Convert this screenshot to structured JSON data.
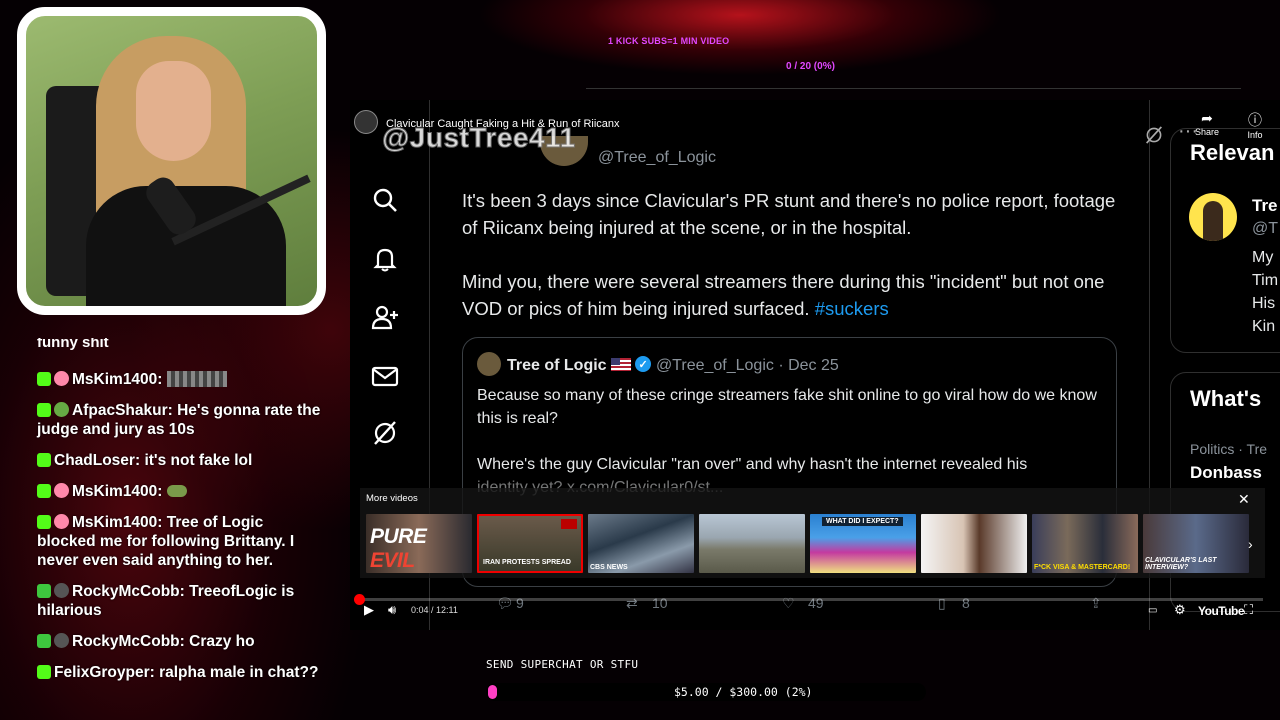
{
  "overlay": {
    "kick_subs": "1 KICK SUBS=1 MIN VIDEO",
    "goal_count": "0 / 20 (0%)"
  },
  "chat": {
    "clipped_top": "funny shit",
    "messages": [
      {
        "platform": "kick",
        "user": "MsKim1400",
        "text": "",
        "emote": "blurred-emote"
      },
      {
        "platform": "kick",
        "user": "AfpacShakur",
        "text": "He's gonna rate the judge and jury as 10s"
      },
      {
        "platform": "kick",
        "user": "ChadLoser",
        "text": "it's not fake lol"
      },
      {
        "platform": "kick",
        "user": "MsKim1400",
        "text": "",
        "emote": "frog-emote"
      },
      {
        "platform": "kick",
        "user": "MsKim1400",
        "text": "Tree of Logic blocked me for following Brittany. I never even said anything to her."
      },
      {
        "platform": "youtube",
        "user": "RockyMcCobb",
        "text": "TreeofLogic is hilarious"
      },
      {
        "platform": "youtube",
        "user": "RockyMcCobb",
        "text": "Crazy ho"
      },
      {
        "platform": "kick",
        "user": "FelixGroyper",
        "text": "ralpha male in chat??"
      }
    ]
  },
  "video": {
    "title": "Clavicular Caught Faking a Hit & Run of Riicanx",
    "watermark": "@JustTree411",
    "share_label": "Share",
    "info_label": "Info",
    "tweet": {
      "handle": "@Tree_of_Logic",
      "paragraphs": [
        "It's been 3 days since Clavicular's PR stunt and there's no police report, footage of Riicanx being injured at the scene, or in the hospital.",
        "Mind you, there were several streamers there during this \"incident\" but not one VOD or pics of him being injured surfaced."
      ],
      "hashtag": "#suckers",
      "quote": {
        "name": "Tree of Logic",
        "handle": "@Tree_of_Logic",
        "date": "· Dec 25",
        "p1": "Because so many of these cringe streamers fake shit online to go viral how do we know this is real?",
        "p2": "Where's the guy Clavicular \"ran over\" and why hasn't the internet revealed his",
        "p3": "identity yet? x.com/Clavicular0/st..."
      },
      "actions": {
        "replies": "9",
        "reposts": "10",
        "likes": "49",
        "bookmarks": "8"
      }
    },
    "sidebar": {
      "relevant": "Relevan",
      "name": "Tre",
      "handle": "@T",
      "bio": [
        "My",
        "Tim",
        "His",
        "Kin"
      ],
      "whats": "What's",
      "trend_meta": "Politics · Tre",
      "trend_name": "Donbass"
    },
    "more_videos": {
      "label": "More videos",
      "thumbs": [
        {
          "caption": "PURE EVIL"
        },
        {
          "caption": "IRAN PROTESTS SPREAD"
        },
        {
          "caption": "CBS NEWS"
        },
        {
          "caption": ""
        },
        {
          "caption": "WHAT DID I EXPECT?"
        },
        {
          "caption": ""
        },
        {
          "caption": "F*CK VISA & MASTERCARD!"
        },
        {
          "caption": "CLAVICULAR'S LAST INTERVIEW?"
        }
      ]
    },
    "player": {
      "time": "0:04 / 12:11",
      "progress_fraction": 0.005,
      "brand": "YouTube"
    }
  },
  "superchat": {
    "label": "SEND SUPERCHAT OR STFU",
    "amount": "$5.00 / $300.00 (2%)",
    "progress_percent": 2,
    "fill_color": "#ff3fc4"
  }
}
